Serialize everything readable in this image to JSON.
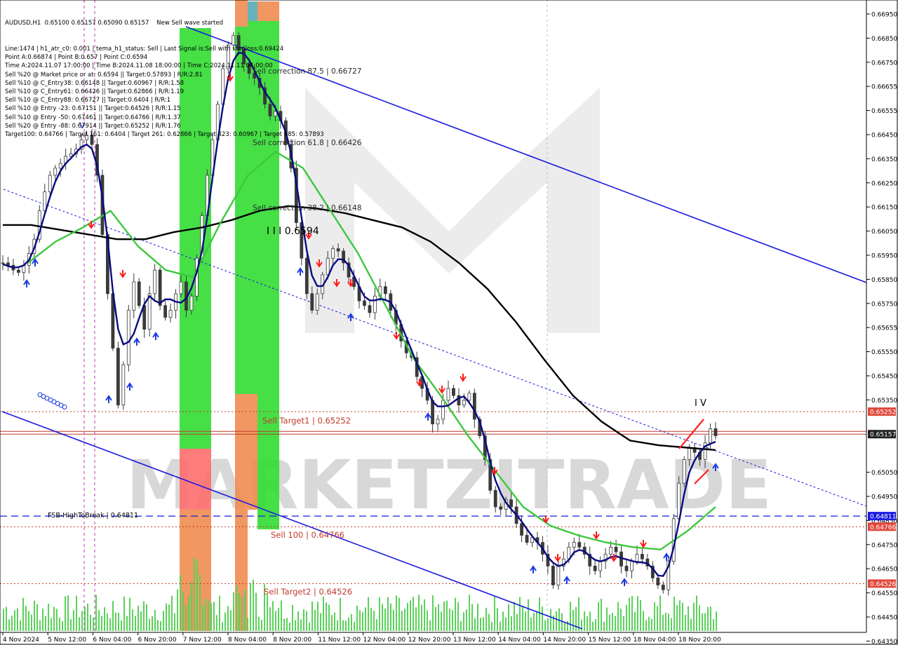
{
  "window": {
    "symbol_line": "AUDUSD,H1  0.65100 0.65157 0.65090 0.65157",
    "signal_label": "New Sell wave started"
  },
  "info_lines": [
    "Line:1474 | h1_atr_c0: 0.001 | tema_h1_status: Sell | Last Signal is:Sell with stoploss:0.69424",
    "Point A:0.66874 | Point B:0.657 | Point C:0.6594",
    "Time A:2024.11.07 17:00:00 | Time B:2024.11.08 18:00:00 | Time C:2024.11.11 04:00:00",
    "Sell %20 @ Market price or at: 0.6594 || Target:0.57893 | R/R:2.81",
    "Sell %10 @ C_Entry38: 0.66148 || Target:0.60967 | R/R:1.58",
    "Sell %10 @ C_Entry61: 0.66426 || Target:0.62866 | R/R:1.19",
    "Sell %10 @ C_Entry88: 0.66727 || Target:0.6404 | R/R:1",
    "Sell %10 @ Entry -23: 0.67151 || Target:0.64526 | R/R:1.15",
    "Sell %10 @ Entry -50: 0.67461 || Target:0.64766 | R/R:1.37",
    "Sell %20 @ Entry -88: 0.67914 || Target:0.65252 | R/R:1.76",
    "Target100: 0.64766 | Target 161: 0.6404 | Target 261: 0.62866 | Target 423: 0.60967 | Target 685: 0.57893"
  ],
  "annotations": {
    "sell_correction_875": "Sell correction 87.5 | 0.66727",
    "sell_correction_618": "Sell correction 61.8 | 0.66426",
    "sell_correction_382": "Sell correction 38.2 | 0.66148",
    "point_c": "I I I 0.6594",
    "wave_label": "I V",
    "sell_target1": "Sell Target1 | 0.65252",
    "fsb": "FSB-HighToBreak  | 0.64811",
    "sell_100": "Sell 100 | 0.64766",
    "sell_target2": "Sell Target2 | 0.64526",
    "watermark": "MARKETZITRADE"
  },
  "price_axis": [
    "0.66950",
    "0.66850",
    "0.66750",
    "0.66655",
    "0.66555",
    "0.66450",
    "0.66350",
    "0.66250",
    "0.66150",
    "0.66050",
    "0.65950",
    "0.65850",
    "0.65750",
    "0.65655",
    "0.65550",
    "0.65450",
    "0.65350",
    "0.65050",
    "0.64950",
    "0.64850",
    "0.64750",
    "0.64650",
    "0.64550",
    "0.64450",
    "0.64350"
  ],
  "price_tags": [
    {
      "text": "0.65252",
      "color": "#e0483c"
    },
    {
      "text": "0.65157",
      "color": "#202020"
    },
    {
      "text": "0.64811",
      "color": "#1a1ae0"
    },
    {
      "text": "0.64766",
      "color": "#e0483c"
    },
    {
      "text": "0.64526",
      "color": "#e0483c"
    }
  ],
  "time_axis": [
    "4 Nov 2024",
    "5 Nov 12:00",
    "6 Nov 04:00",
    "6 Nov 20:00",
    "7 Nov 12:00",
    "8 Nov 04:00",
    "8 Nov 20:00",
    "11 Nov 12:00",
    "12 Nov 04:00",
    "12 Nov 20:00",
    "13 Nov 12:00",
    "14 Nov 04:00",
    "14 Nov 20:00",
    "15 Nov 12:00",
    "18 Nov 04:00",
    "18 Nov 20:00"
  ],
  "colors": {
    "candle": "#3a3a3a",
    "ma_black": "#000000",
    "ma_navy": "#0a0a80",
    "ma_green": "#3cc83c",
    "trend_blue": "#1a1ae0",
    "level_red": "#c0392b",
    "volume": "#5ad25a",
    "zone_green": "#32dc32",
    "zone_red": "#ff6e6e",
    "zone_orange": "#f08c50",
    "zone_teal": "#5aaab4"
  },
  "chart_data": {
    "type": "candlestick",
    "title": "AUDUSD,H1",
    "timeframe": "H1",
    "ohlc_last": {
      "open": 0.651,
      "high": 0.65157,
      "low": 0.6509,
      "close": 0.65157
    },
    "ylim": [
      0.6432,
      0.6699
    ],
    "points": {
      "A": 0.66874,
      "B": 0.657,
      "C": 0.6594
    },
    "levels": {
      "sell_target1": 0.65252,
      "fsb_high_to_break": 0.64811,
      "sell_100": 0.64766,
      "sell_target2": 0.64526,
      "current": 0.65157
    },
    "close_path": [
      [
        0.6588,
        0.6587,
        0.6585,
        0.6584,
        0.6587,
        0.6592,
        0.6598,
        0.661,
        0.6618,
        0.6625,
        0.6628,
        0.663,
        0.6633,
        0.6634,
        0.6636,
        0.664,
        0.6642,
        0.6638,
        0.6625,
        0.66,
        0.6575,
        0.6552,
        0.6528,
        0.6545,
        0.6568,
        0.658,
        0.657,
        0.656,
        0.6575,
        0.6585,
        0.657,
        0.6565,
        0.6568,
        0.6575,
        0.658,
        0.6568,
        0.6574,
        0.659,
        0.6608,
        0.6625,
        0.664,
        0.6655,
        0.667,
        0.668,
        0.6684,
        0.6678,
        0.6672,
        0.6668,
        0.6666,
        0.6662,
        0.6655,
        0.665,
        0.6652,
        0.6648,
        0.6638,
        0.6628,
        0.6605,
        0.659,
        0.6575,
        0.6568,
        0.6575,
        0.6583,
        0.659,
        0.6594,
        0.6593,
        0.6588,
        0.6582,
        0.6578,
        0.6572,
        0.657,
        0.6567,
        0.6574,
        0.6578,
        0.6575,
        0.6568,
        0.6562,
        0.6555,
        0.655,
        0.6548,
        0.654,
        0.6535,
        0.653,
        0.652,
        0.6522,
        0.653,
        0.6535,
        0.6532,
        0.6528,
        0.653,
        0.6533,
        0.6522,
        0.6515,
        0.6505,
        0.6492,
        0.6485,
        0.6484,
        0.6488,
        0.6485,
        0.6478,
        0.6473,
        0.647,
        0.6472,
        0.647,
        0.6465,
        0.646,
        0.6452,
        0.646,
        0.6463,
        0.6468,
        0.647,
        0.6468,
        0.6465,
        0.646,
        0.6458,
        0.6462,
        0.6465,
        0.6468,
        0.6466,
        0.646,
        0.6458,
        0.6462,
        0.6465,
        0.6463,
        0.646,
        0.6455,
        0.6452,
        0.645,
        0.6462,
        0.648,
        0.6495,
        0.6505,
        0.651,
        0.6508,
        0.6505,
        0.6512,
        0.6518,
        0.6515
      ]
    ],
    "indicators": {
      "ma_black_path": [
        0.6604,
        0.6604,
        0.6602,
        0.66,
        0.6598,
        0.6598,
        0.6601,
        0.6603,
        0.6606,
        0.661,
        0.6612,
        0.6611,
        0.6609,
        0.6606,
        0.6603,
        0.6597,
        0.6588,
        0.6577,
        0.6563,
        0.6547,
        0.6532,
        0.6521,
        0.6513,
        0.6511,
        0.651,
        0.6509
      ],
      "ma_green_path": [
        0.6588,
        0.6597,
        0.6603,
        0.661,
        0.6595,
        0.6585,
        0.6582,
        0.6605,
        0.6625,
        0.6635,
        0.6628,
        0.661,
        0.6592,
        0.657,
        0.6548,
        0.6532,
        0.6515,
        0.65,
        0.6485,
        0.6477,
        0.6473,
        0.647,
        0.6468,
        0.6467,
        0.6475,
        0.6485
      ]
    }
  }
}
